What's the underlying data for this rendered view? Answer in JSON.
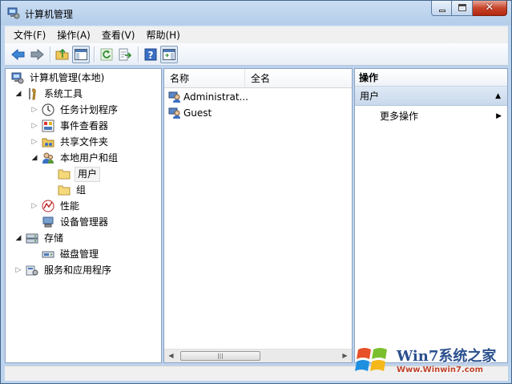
{
  "window": {
    "title": "计算机管理",
    "caption_close": "✕"
  },
  "menu": [
    "文件(F)",
    "操作(A)",
    "查看(V)",
    "帮助(H)"
  ],
  "toolbar": {
    "icons": [
      "back-arrow-icon",
      "forward-arrow-icon",
      "up-folder-icon",
      "show-hide-console-tree-icon",
      "refresh-icon",
      "export-list-icon",
      "help-icon",
      "show-hide-action-pane-icon"
    ]
  },
  "tree": {
    "root": "计算机管理(本地)",
    "system_tools": "系统工具",
    "task_scheduler": "任务计划程序",
    "event_viewer": "事件查看器",
    "shared_folders": "共享文件夹",
    "local_users_groups": "本地用户和组",
    "users": "用户",
    "groups": "组",
    "performance": "性能",
    "device_manager": "设备管理器",
    "storage": "存储",
    "disk_management": "磁盘管理",
    "services_apps": "服务和应用程序"
  },
  "list": {
    "columns": [
      "名称",
      "全名"
    ],
    "rows": [
      {
        "name": "Administrat...",
        "full_name": ""
      },
      {
        "name": "Guest",
        "full_name": ""
      }
    ],
    "scroll_thumb": "|||"
  },
  "actions": {
    "title": "操作",
    "group": "用户",
    "more": "更多操作"
  },
  "watermark": {
    "line1": "Win7系统之家",
    "line2": "Www.Winwin7.com"
  },
  "colors": {
    "frame": "#bcd3ee",
    "selection_highlight": "#c9d9ec",
    "close_button": "#c6452b"
  }
}
